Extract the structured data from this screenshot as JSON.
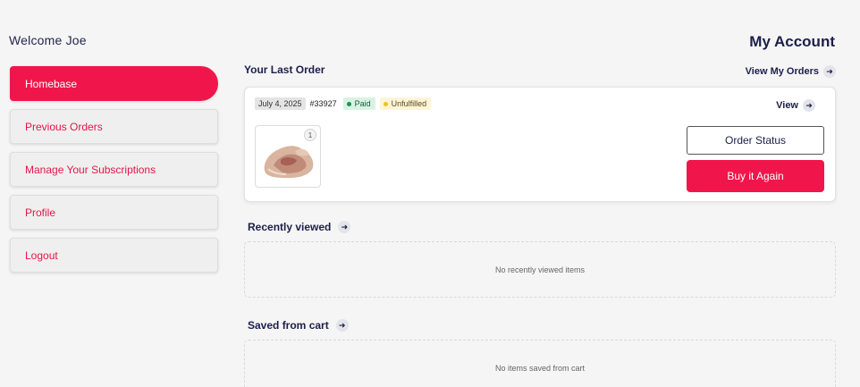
{
  "header": {
    "welcome": "Welcome Joe",
    "title": "My Account"
  },
  "sidebar": {
    "items": [
      {
        "label": "Homebase"
      },
      {
        "label": "Previous Orders"
      },
      {
        "label": "Manage Your Subscriptions"
      },
      {
        "label": "Profile"
      },
      {
        "label": "Logout"
      }
    ]
  },
  "last_order": {
    "section_title": "Your Last Order",
    "view_all": "View My Orders",
    "date": "July 4, 2025",
    "number": "#33927",
    "payment_status": "Paid",
    "fulfillment_status": "Unfulfilled",
    "view_label": "View",
    "item_quantity": "1",
    "order_status_button": "Order Status",
    "buy_again_button": "Buy it Again"
  },
  "recently_viewed": {
    "title": "Recently viewed",
    "empty_text": "No recently viewed items"
  },
  "saved_from_cart": {
    "title": "Saved from cart",
    "empty_text": "No items saved from cart"
  },
  "colors": {
    "accent": "#f0164b",
    "text": "#1c1f4a",
    "paid_bg": "#d8f3e3",
    "unfulfilled_bg": "#fdf5d8"
  },
  "icons": {
    "arrow": "arrow-right-circle-icon",
    "product": "product-thumbnail"
  }
}
